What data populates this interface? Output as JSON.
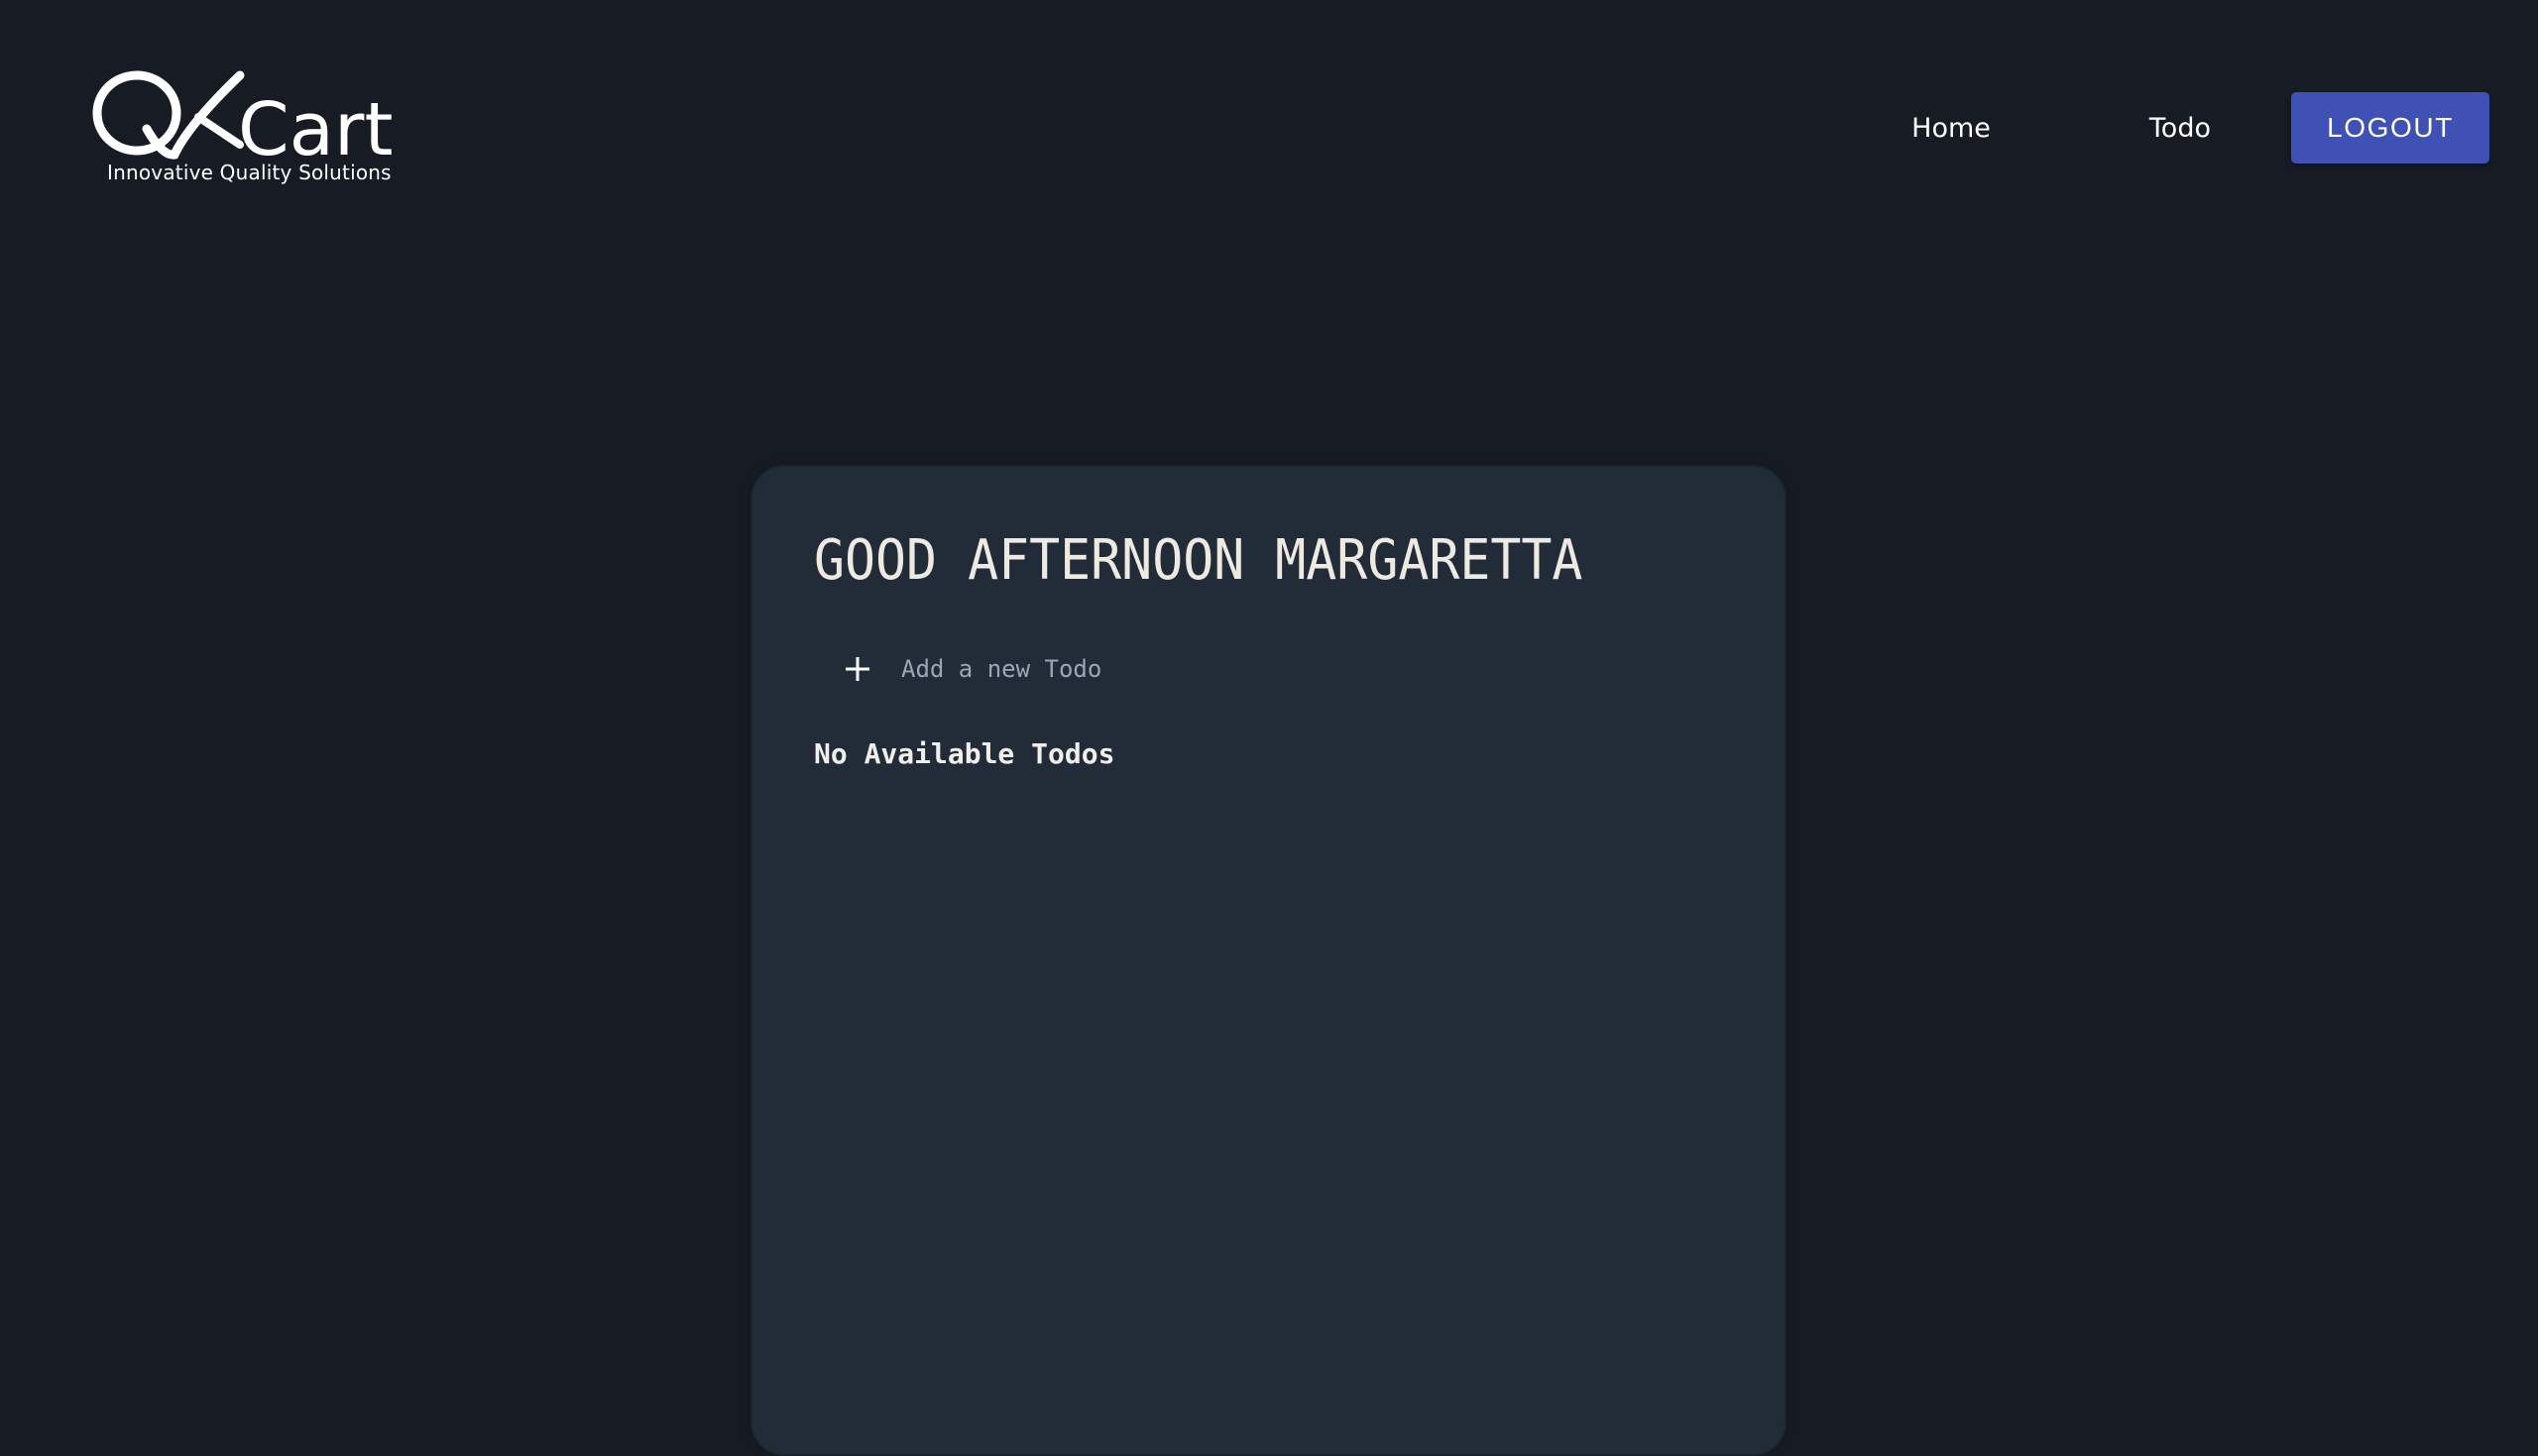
{
  "logo": {
    "brand_text": "QKart",
    "tagline": "Innovative Quality Solutions"
  },
  "nav": {
    "home_label": "Home",
    "todo_label": "Todo",
    "logout_label": "LOGOUT"
  },
  "card": {
    "greeting": "GOOD AFTERNOON MARGARETTA",
    "add_placeholder": "Add a new Todo",
    "add_icon": "plus-icon",
    "empty_message": "No Available Todos"
  },
  "colors": {
    "background": "#171c24",
    "card": "#222c38",
    "accent": "#3f51b5",
    "text": "#eeeae2",
    "placeholder": "#9aa7b6"
  }
}
